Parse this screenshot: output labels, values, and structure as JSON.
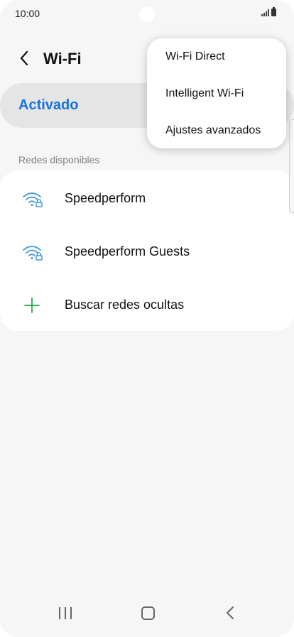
{
  "status_bar": {
    "time": "10:00"
  },
  "header": {
    "title": "Wi-Fi"
  },
  "wifi_toggle": {
    "label": "Activado"
  },
  "networks_section": {
    "label": "Redes disponibles"
  },
  "networks": [
    {
      "name": "Speedperform",
      "icon": "wifi-lock-icon"
    },
    {
      "name": "Speedperform Guests",
      "icon": "wifi-lock-icon"
    }
  ],
  "hidden_networks": {
    "label": "Buscar redes ocultas",
    "icon": "plus-icon"
  },
  "overflow_menu": {
    "items": [
      "Wi-Fi Direct",
      "Intelligent Wi-Fi",
      "Ajustes avanzados"
    ]
  },
  "colors": {
    "accent": "#1a73d9",
    "wifi_icon": "#3a95e0",
    "add_icon": "#23a84a"
  }
}
